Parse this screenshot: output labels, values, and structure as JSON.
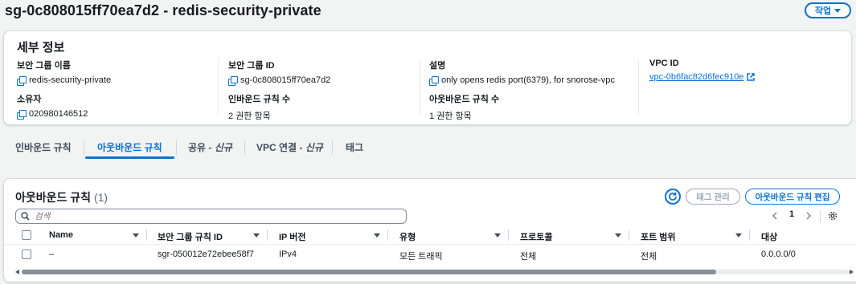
{
  "header": {
    "title": "sg-0c808015ff70ea7d2 - redis-security-private",
    "action_label": "작업"
  },
  "details": {
    "title": "세부 정보",
    "fields": [
      {
        "label": "보안 그룹 이름",
        "value": "redis-security-private"
      },
      {
        "label": "보안 그룹 ID",
        "value": "sg-0c808015ff70ea7d2"
      },
      {
        "label": "설명",
        "value": "only opens redis port(6379), for snorose-vpc"
      },
      {
        "label": "VPC ID",
        "value": "vpc-0b6fac82d6fec910e"
      },
      {
        "label": "소유자",
        "value": "020980146512"
      },
      {
        "label": "인바운드 규칙 수",
        "value": "2 권한 항목"
      },
      {
        "label": "아웃바운드 규칙 수",
        "value": "1 권한 항목"
      }
    ]
  },
  "tabs": [
    {
      "label": "인바운드 규칙"
    },
    {
      "label": "아웃바운드 규칙"
    },
    {
      "label": "공유 - ",
      "badge": "신규"
    },
    {
      "label": "VPC 연결 - ",
      "badge": "신규"
    },
    {
      "label": "태그"
    }
  ],
  "rules": {
    "title": "아웃바운드 규칙",
    "count": "(1)",
    "manage_tags_label": "태그 관리",
    "edit_label": "아웃바운드 규칙 편집",
    "search_placeholder": "검색",
    "page": "1",
    "columns": [
      "Name",
      "보안 그룹 규칙 ID",
      "IP 버전",
      "유형",
      "프로토콜",
      "포트 범위",
      "대상"
    ],
    "rows": [
      {
        "name": "–",
        "rule_id": "sgr-050012e72ebee58f7",
        "ip_version": "IPv4",
        "type": "모든 트래픽",
        "protocol": "전체",
        "port_range": "전체",
        "destination": "0.0.0.0/0"
      }
    ]
  },
  "colors": {
    "accent": "#0972d3",
    "text": "#16191f",
    "background": "#f2f3f3"
  }
}
